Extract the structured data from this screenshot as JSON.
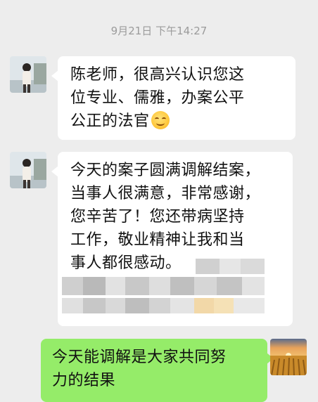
{
  "chat": {
    "timestamp": "9月21日 下午14:27",
    "messages": [
      {
        "sender": "other",
        "lines": [
          "陈老师，很高兴认识您这",
          "位专业、儒雅，办案公平",
          "公正的法官"
        ],
        "emoji": "smile-emoji"
      },
      {
        "sender": "other",
        "lines": [
          "今天的案子圆满调解结案，",
          "当事人很满意，非常感谢，",
          "您辛苦了！您还带病坚持",
          "工作，敬业精神让我和当",
          "事人都很感动。"
        ],
        "redacted": true
      },
      {
        "sender": "self",
        "lines": [
          "今天能调解是大家共同努",
          "力的结果"
        ]
      }
    ]
  },
  "colors": {
    "background": "#ededed",
    "incoming_bubble": "#ffffff",
    "outgoing_bubble": "#95ec69",
    "timestamp_text": "#9b9b9b"
  }
}
